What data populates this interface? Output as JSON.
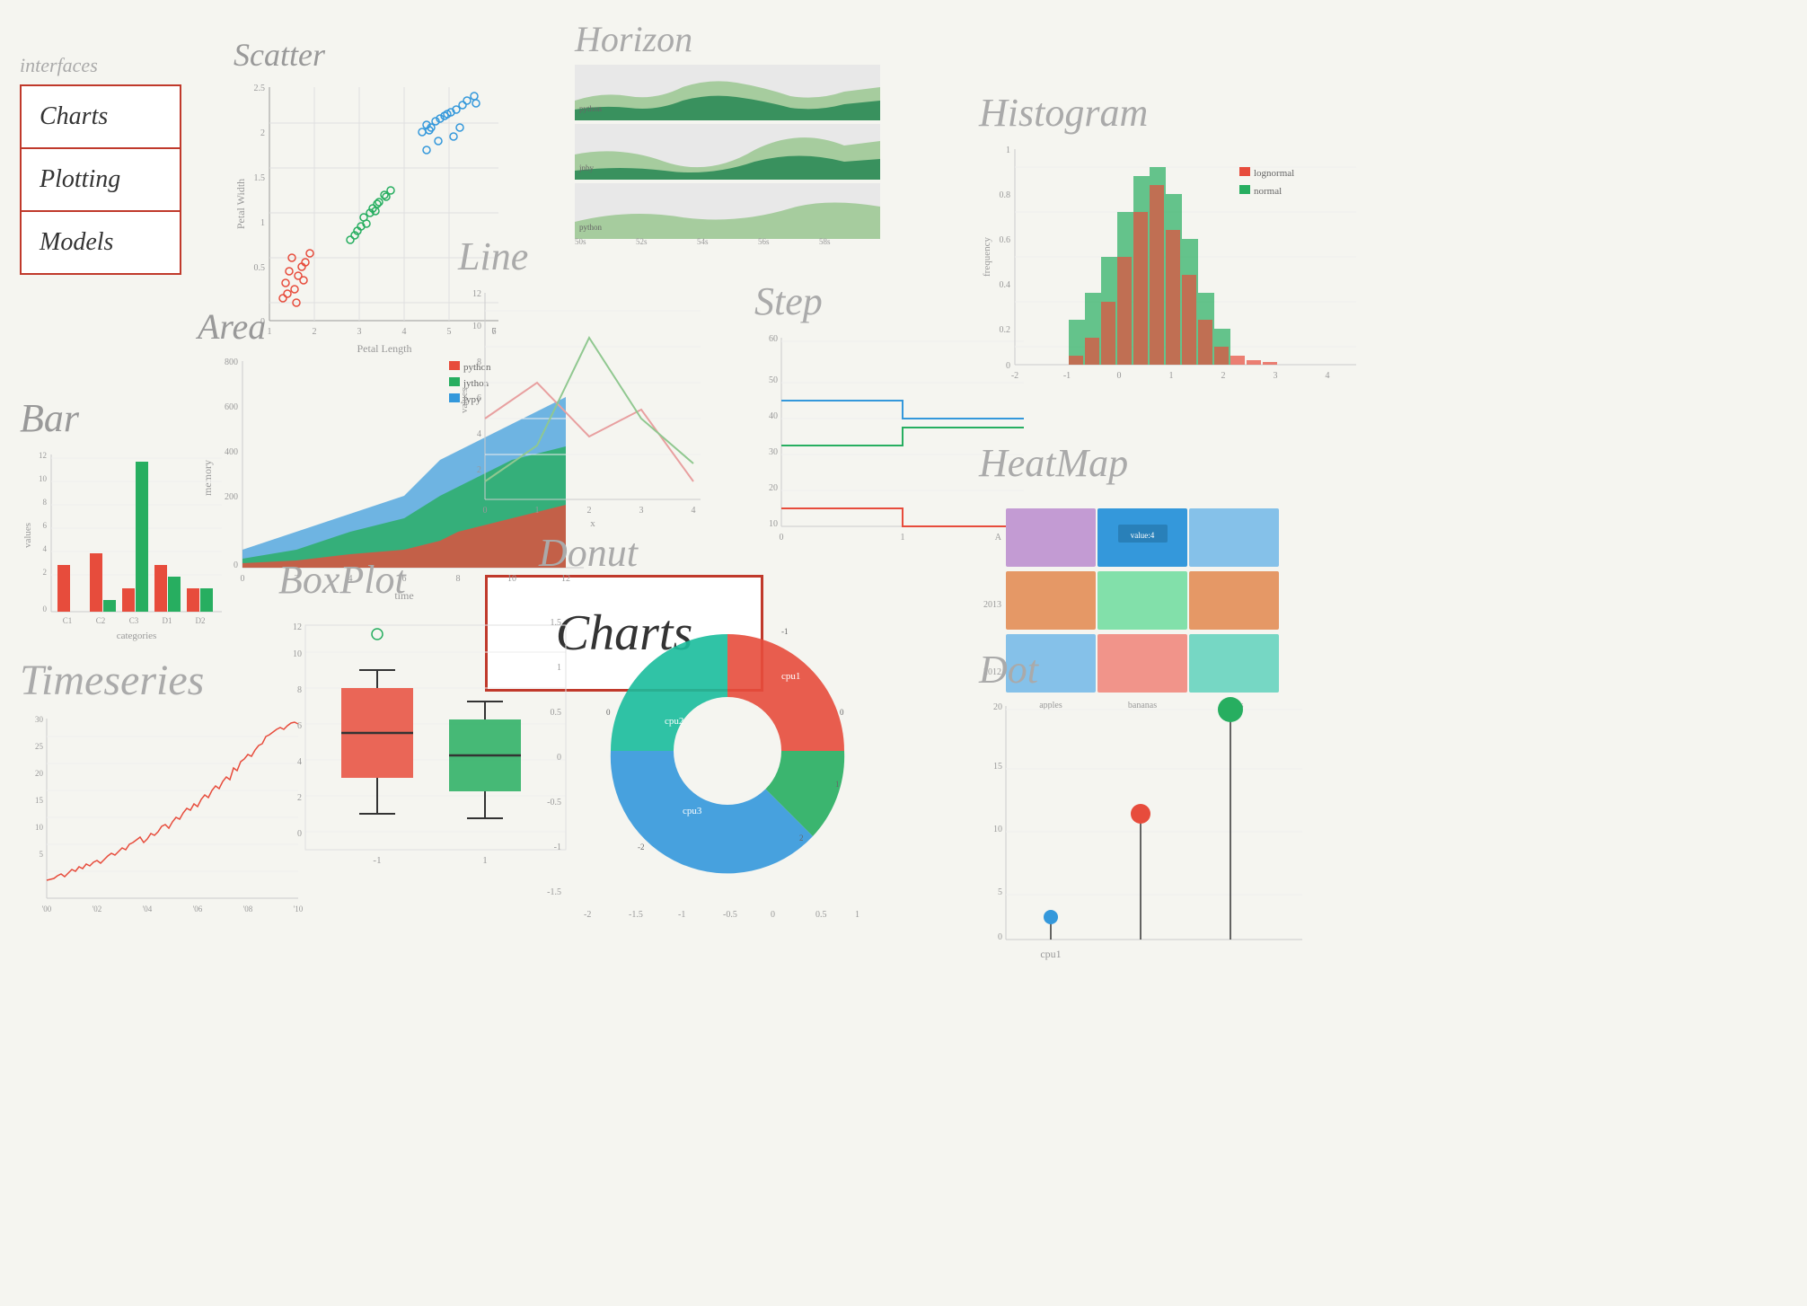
{
  "sidebar": {
    "label": "interfaces",
    "items": [
      "Charts",
      "Plotting",
      "Models"
    ]
  },
  "charts_center": {
    "text": "Charts"
  },
  "sections": {
    "scatter": {
      "title": "Scatter",
      "x_label": "Petal Length",
      "y_label": "Petal Width"
    },
    "area": {
      "title": "Area",
      "x_label": "time",
      "y_label": "memory",
      "series": [
        "python",
        "jython",
        "jypy"
      ]
    },
    "bar": {
      "title": "Bar",
      "x_label": "categories",
      "y_label": "values"
    },
    "timeseries": {
      "title": "Timeseries"
    },
    "horizon": {
      "title": "Horizon",
      "series": [
        "python",
        "jnby",
        "python"
      ]
    },
    "line": {
      "title": "Line",
      "x_label": "x",
      "y_label": "values"
    },
    "step": {
      "title": "Step"
    },
    "boxplot": {
      "title": "BoxPlot"
    },
    "donut": {
      "title": "Donut",
      "labels": [
        "cpu1",
        "cpu2",
        "cpu3"
      ]
    },
    "histogram": {
      "title": "Histogram",
      "legend": [
        "lognormal",
        "normal"
      ],
      "x_label": "",
      "y_label": "frequency"
    },
    "heatmap": {
      "title": "HeatMap"
    },
    "dot": {
      "title": "Dot",
      "x_label": "cpu1"
    }
  }
}
